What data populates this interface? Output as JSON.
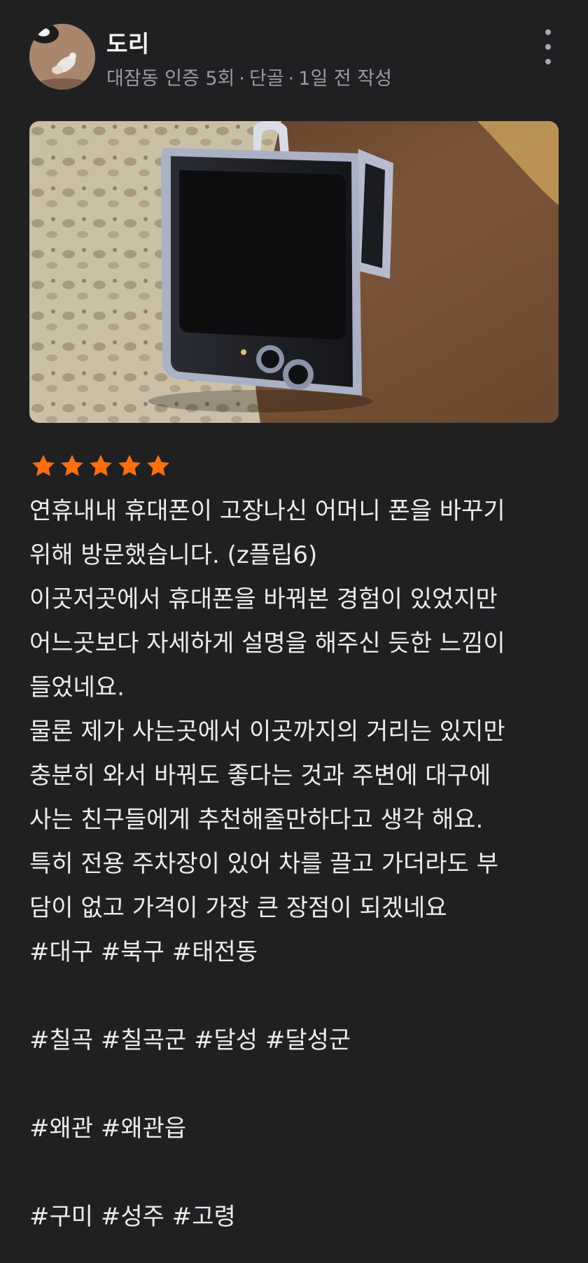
{
  "author": {
    "name": "도리",
    "location_badge": "대잠동 인증 5회",
    "regular_badge": "단골",
    "posted": "1일 전 작성",
    "separator": "·"
  },
  "review": {
    "rating": 5,
    "rating_max": 5,
    "star_color": "#ff6f0f",
    "lines": [
      "연휴내내 휴대폰이 고장나신 어머니 폰을 바꾸기",
      "위해 방문했습니다. (z플립6)",
      "이곳저곳에서 휴대폰을 바꿔본 경험이 있었지만",
      "어느곳보다 자세하게 설명을 해주신 듯한 느낌이",
      "들었네요.",
      "물론 제가 사는곳에서 이곳까지의 거리는 있지만",
      "충분히 와서 바꿔도 좋다는 것과 주변에 대구에",
      "사는 친구들에게 추천해줄만하다고 생각 해요.",
      "특히 전용 주차장이 있어 차를 끌고 가더라도 부",
      "담이 없고 가격이 가장 큰 장점이 되겠네요",
      "#대구 #북구 #태전동",
      "",
      "#칠곡 #칠곡군 #달성 #달성군",
      "",
      "#왜관 #왜관읍",
      "",
      "#구미 #성주 #고령"
    ]
  },
  "icons": {
    "more": "more-vertical-icon",
    "star": "star-icon"
  },
  "colors": {
    "background": "#202023",
    "text": "#ececec",
    "meta": "#9a9aa0"
  }
}
